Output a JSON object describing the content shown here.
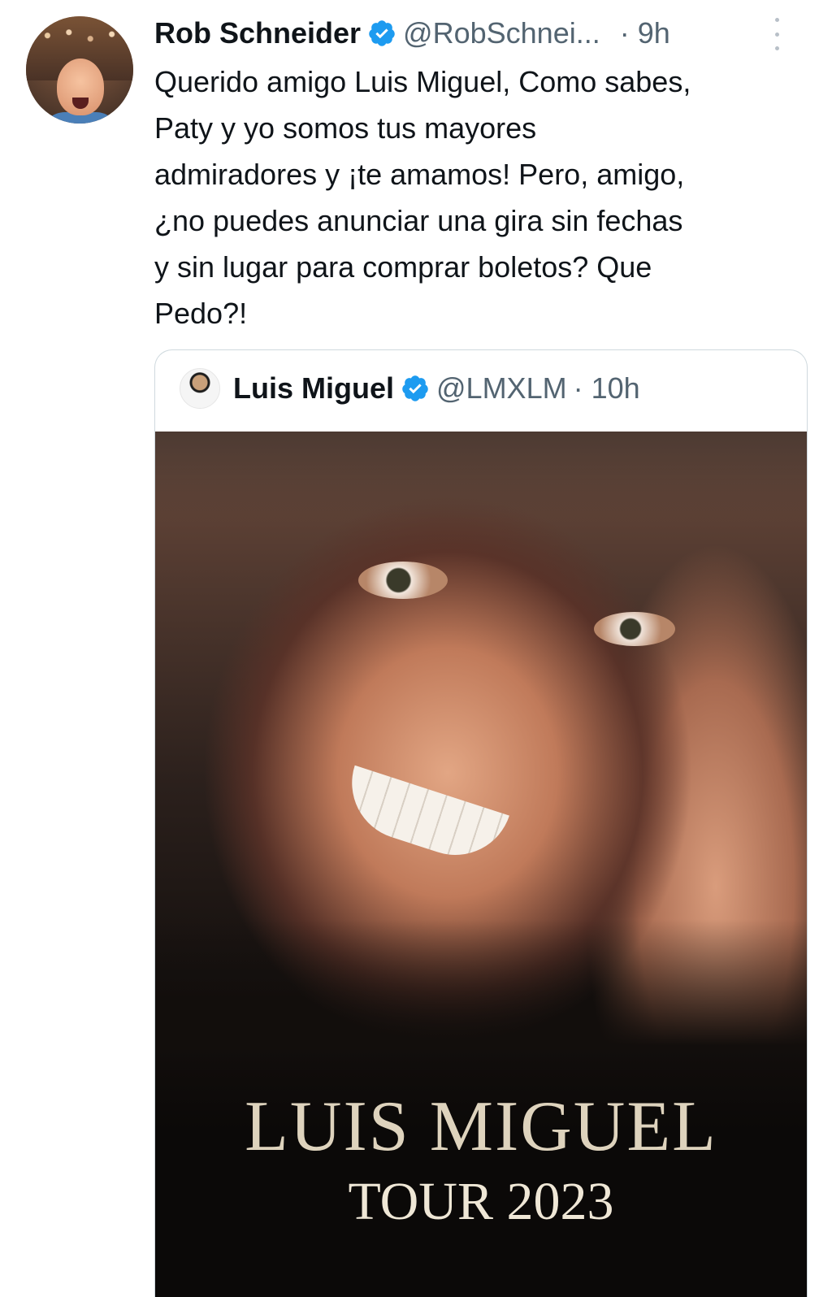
{
  "tweet": {
    "author": {
      "name": "Rob Schneider",
      "handle": "@RobSchnei...",
      "time": "· 9h"
    },
    "lines": [
      "Querido amigo Luis Miguel, Como sabes,",
      "Paty y yo somos tus mayores",
      "admiradores y ¡te amamos!  Pero, amigo,",
      "¿no puedes anunciar una gira sin fechas",
      "y sin lugar para comprar boletos?  Que",
      "Pedo?!"
    ],
    "more_icon": "more-vertical-icon"
  },
  "quoted_tweet": {
    "author": {
      "name": "Luis Miguel",
      "handle": "@LMXLM",
      "time": "· 10h"
    },
    "poster": {
      "title": "LUIS MIGUEL",
      "subtitle": "TOUR 2023"
    }
  },
  "colors": {
    "verified": "#1d9bf0",
    "secondary_text": "#536471",
    "border": "#cfd9de"
  }
}
